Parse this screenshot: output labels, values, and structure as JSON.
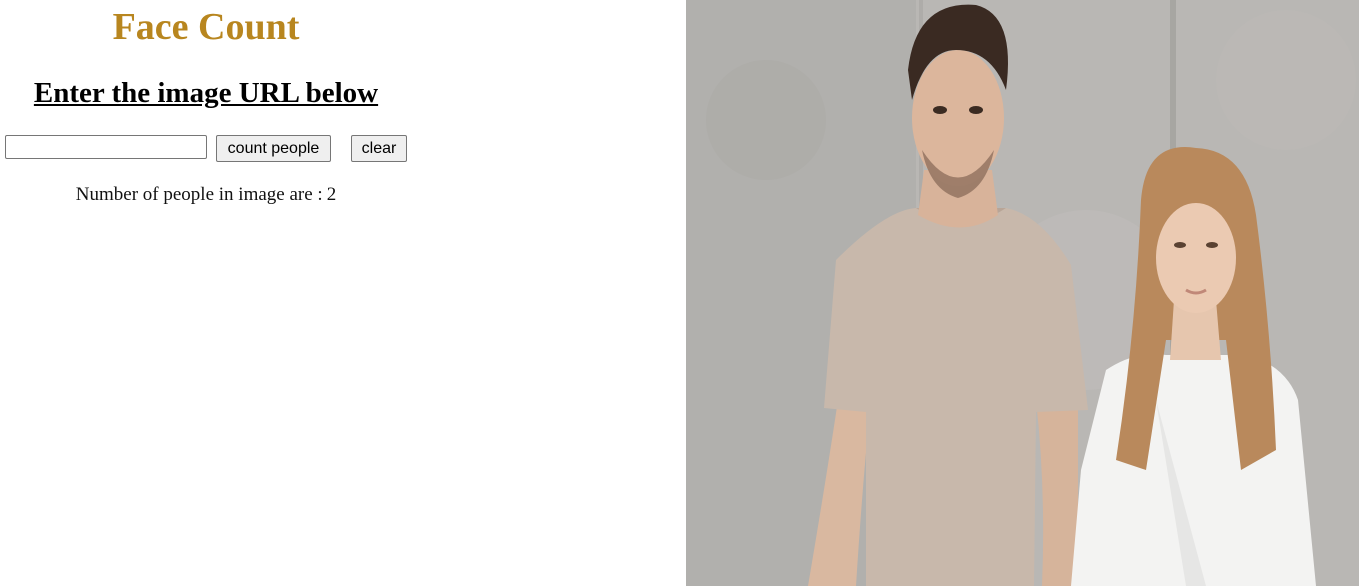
{
  "header": {
    "title": "Face Count",
    "title_color": "#b8861f",
    "subtitle": "Enter the image URL below"
  },
  "form": {
    "url_value": "",
    "count_button_label": "count people",
    "clear_button_label": "clear"
  },
  "result": {
    "label": "Number of people in image are :",
    "count": "2"
  },
  "photo": {
    "subject": "two-people-standing-photo"
  }
}
